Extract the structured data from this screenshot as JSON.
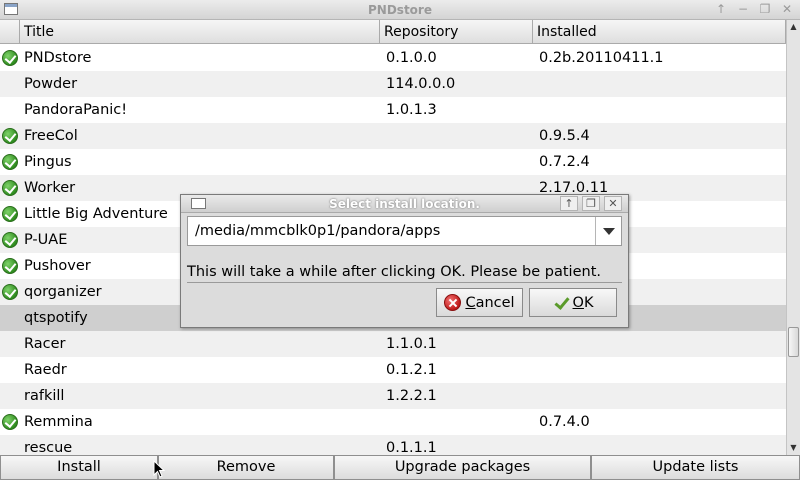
{
  "window": {
    "title": "PNDstore"
  },
  "table": {
    "columns": [
      "Title",
      "Repository",
      "Installed"
    ],
    "rows": [
      {
        "title": "PNDstore",
        "repository": "0.1.0.0",
        "installed": "0.2b.20110411.1",
        "check": true
      },
      {
        "title": "Powder",
        "repository": "114.0.0.0",
        "installed": "",
        "check": false
      },
      {
        "title": "PandoraPanic!",
        "repository": "1.0.1.3",
        "installed": "",
        "check": false
      },
      {
        "title": "FreeCol",
        "repository": "",
        "installed": "0.9.5.4",
        "check": true
      },
      {
        "title": "Pingus",
        "repository": "",
        "installed": "0.7.2.4",
        "check": true
      },
      {
        "title": "Worker",
        "repository": "",
        "installed": "2.17.0.11",
        "check": true
      },
      {
        "title": "Little Big Adventure",
        "repository": "",
        "installed": "",
        "check": true
      },
      {
        "title": "P-UAE",
        "repository": "",
        "installed": "",
        "check": true
      },
      {
        "title": "Pushover",
        "repository": "",
        "installed": "",
        "check": true
      },
      {
        "title": "qorganizer",
        "repository": "",
        "installed": "",
        "check": true
      },
      {
        "title": "qtspotify",
        "repository": "",
        "installed": "",
        "check": false,
        "selected": true
      },
      {
        "title": "Racer",
        "repository": "1.1.0.1",
        "installed": "",
        "check": false
      },
      {
        "title": "Raedr",
        "repository": "0.1.2.1",
        "installed": "",
        "check": false
      },
      {
        "title": "rafkill",
        "repository": "1.2.2.1",
        "installed": "",
        "check": false
      },
      {
        "title": "Remmina",
        "repository": "",
        "installed": "0.7.4.0",
        "check": true
      },
      {
        "title": "rescue",
        "repository": "0.1.1.1",
        "installed": "",
        "check": false
      }
    ]
  },
  "buttons": {
    "install": "Install",
    "remove": "Remove",
    "upgrade": "Upgrade packages",
    "update": "Update lists"
  },
  "dialog": {
    "title": "Select install location.",
    "location": "/media/mmcblk0p1/pandora/apps",
    "message": "This will take a while after clicking OK.  Please be patient.",
    "cancel_label": "Cancel",
    "ok_label": "OK"
  }
}
